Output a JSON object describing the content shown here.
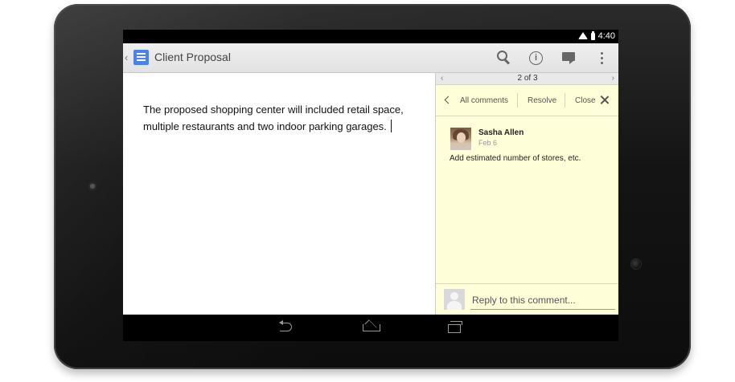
{
  "status_bar": {
    "time": "4:40",
    "icons": [
      "wifi-icon",
      "battery-icon"
    ]
  },
  "app_bar": {
    "title": "Client Proposal",
    "actions": [
      "search-icon",
      "info-icon",
      "comment-icon",
      "overflow-menu-icon"
    ]
  },
  "document": {
    "body": "The proposed shopping center will included retail space, multiple restaurants and two indoor parking garages."
  },
  "comments_pane": {
    "pager": "2 of 3",
    "toolbar": {
      "all_comments": "All comments",
      "resolve": "Resolve",
      "close": "Close"
    },
    "comment": {
      "author": "Sasha Allen",
      "date": "Feb 6",
      "text": "Add estimated number of stores, etc."
    },
    "reply": {
      "placeholder": "Reply to this comment..."
    }
  },
  "nav_bar": {
    "buttons": [
      "back",
      "home",
      "recents"
    ]
  },
  "colors": {
    "doc_icon": "#4a82ec",
    "comment_bg": "#fefed9",
    "appbar_bg": "#e9e9e9"
  }
}
